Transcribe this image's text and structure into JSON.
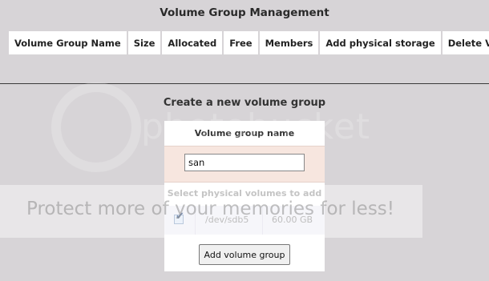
{
  "page_title": "Volume Group Management",
  "table_headers": [
    "Volume Group Name",
    "Size",
    "Allocated",
    "Free",
    "Members",
    "Add physical storage",
    "Delete VG"
  ],
  "create_section_title": "Create a new volume group",
  "form": {
    "name_label": "Volume group name",
    "name_value": "san",
    "pv_label": "Select physical volumes to add",
    "physical_volumes": [
      {
        "device": "/dev/sdb5",
        "size": "60.00 GB",
        "checked": true
      }
    ],
    "submit_label": "Add volume group"
  },
  "watermark": {
    "logo_text": "photobucket",
    "banner_text": "Protect more of your memories for less!"
  },
  "colors": {
    "background": "#d7d4d7",
    "input_row": "#f7e6df",
    "pv_row": "#f0eff6"
  }
}
